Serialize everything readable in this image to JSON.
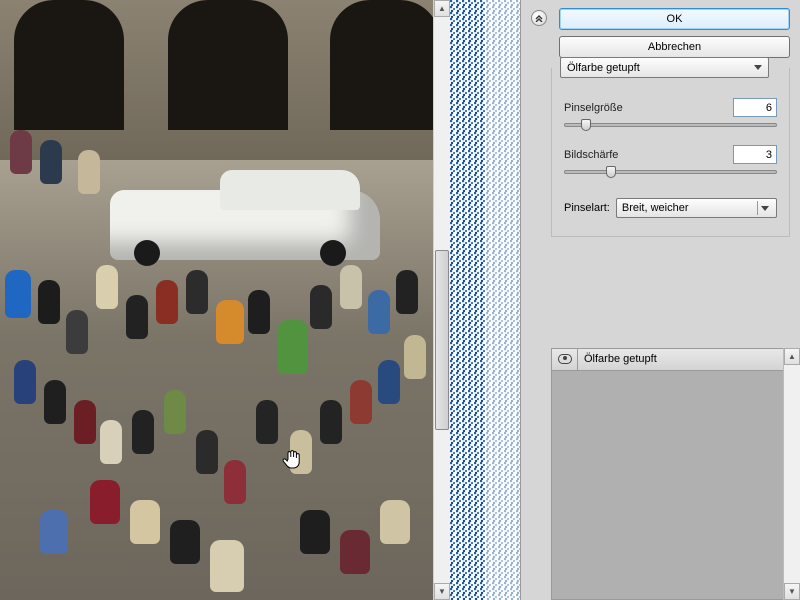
{
  "buttons": {
    "ok": "OK",
    "cancel": "Abbrechen"
  },
  "filter": {
    "selected": "Ölfarbe getupft"
  },
  "params": {
    "brush_size": {
      "label": "Pinselgröße",
      "value": "6",
      "slider_pct": 10
    },
    "sharpness": {
      "label": "Bildschärfe",
      "value": "3",
      "slider_pct": 22
    }
  },
  "brush": {
    "label": "Pinselart:",
    "selected": "Breit, weicher"
  },
  "layers": {
    "items": [
      {
        "name": "Ölfarbe getupft"
      }
    ]
  }
}
